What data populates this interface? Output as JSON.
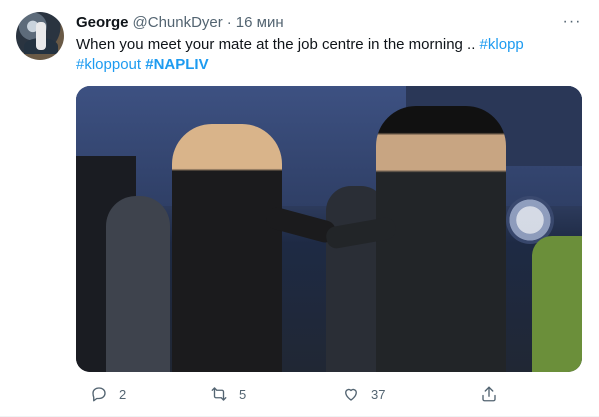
{
  "tweet": {
    "author_name": "George",
    "author_handle": "@ChunkDyer",
    "separator": "·",
    "time": "16 мин",
    "more_label": "···",
    "text_line": "When you meet your mate at the job centre in the morning ..",
    "hashtags": [
      "#klopp",
      "#kloppout",
      "#NAPLIV"
    ]
  },
  "actions": {
    "reply_count": "2",
    "retweet_count": "5",
    "like_count": "37"
  },
  "icons": {
    "reply": "reply-icon",
    "retweet": "retweet-icon",
    "like": "heart-icon",
    "share": "share-icon",
    "more": "more-icon"
  },
  "colors": {
    "link": "#1d9bf0",
    "muted": "#536471",
    "text": "#0f1419"
  }
}
